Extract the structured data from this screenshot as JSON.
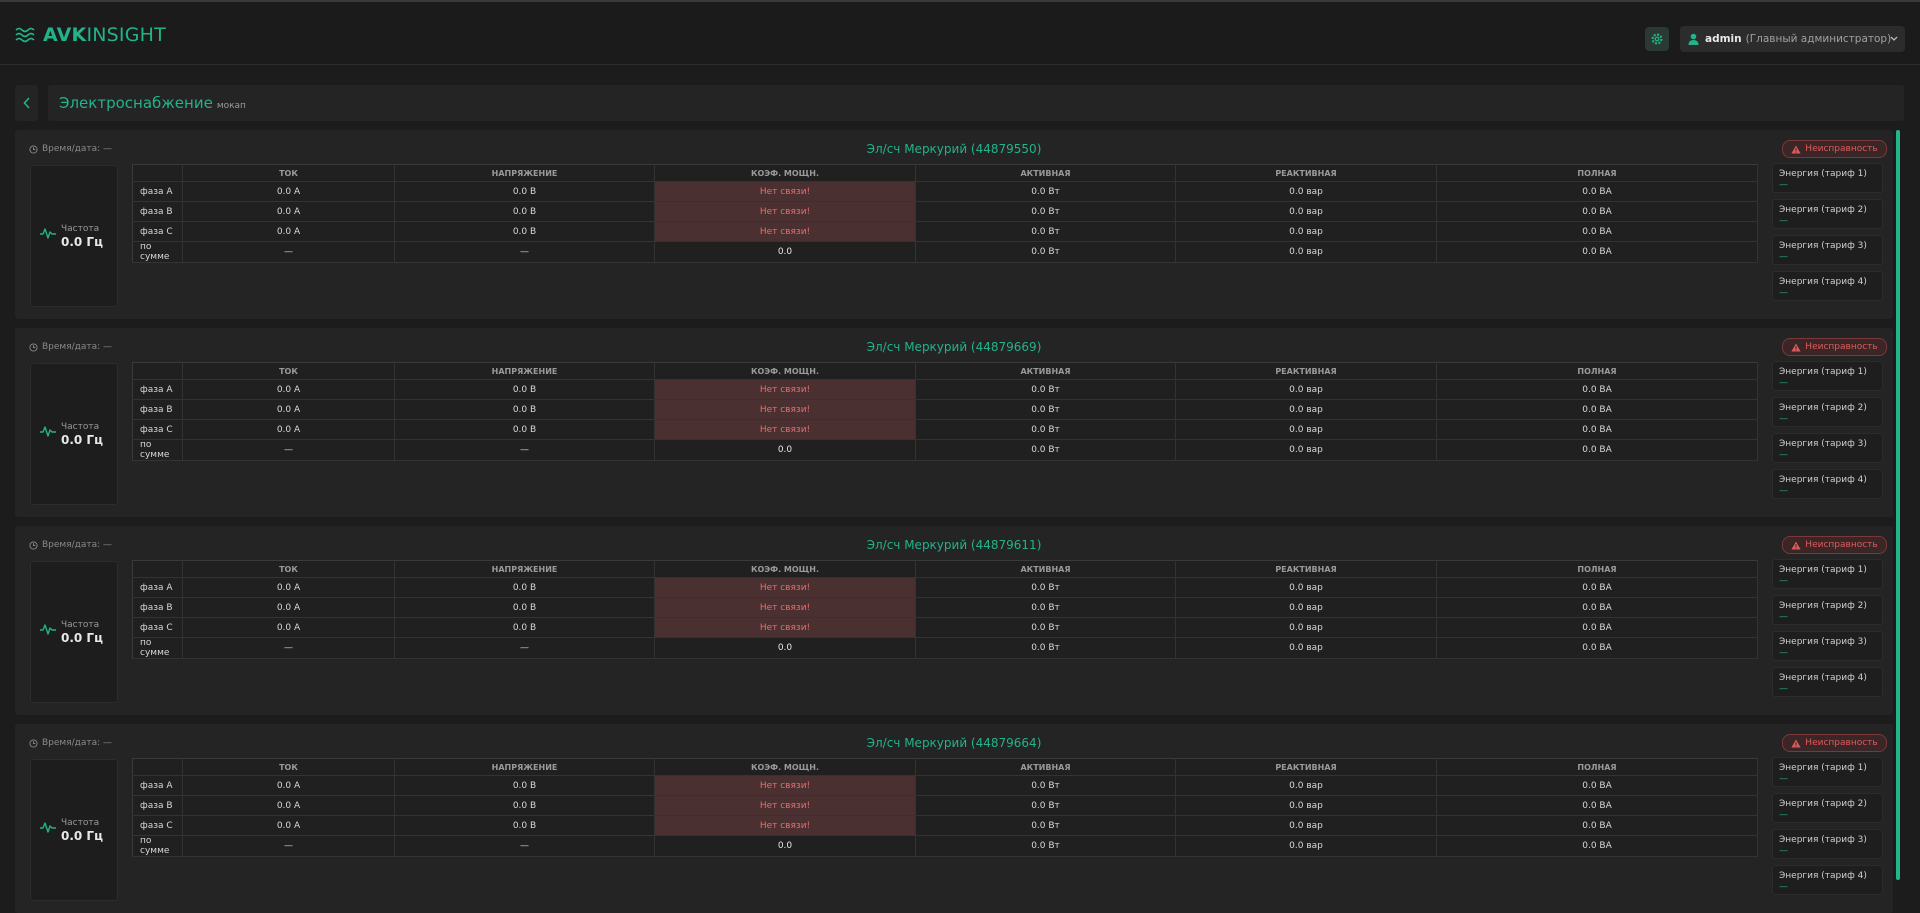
{
  "header": {
    "logo_bold": "AVK",
    "logo_light": "INSIGHT",
    "user_name": "admin",
    "user_role": "(Главный администратор)"
  },
  "page": {
    "title": "Электроснабжение",
    "subtitle": "мокап"
  },
  "meter_labels": {
    "datetime_label": "Время/дата: —",
    "fault_label": "Неисправность",
    "freq_label": "Частота",
    "freq_value": "0.0 Гц",
    "col_current": "ТОК",
    "col_voltage": "НАПРЯЖЕНИЕ",
    "col_pf": "КОЭФ. МОЩН.",
    "col_active": "АКТИВНАЯ",
    "col_reactive": "РЕАКТИВНАЯ",
    "col_full": "ПОЛНАЯ",
    "rows": [
      {
        "phase": "фаза A",
        "current": "0.0 А",
        "voltage": "0.0 В",
        "pf": "Нет связи!",
        "active": "0.0 Вт",
        "reactive": "0.0 вар",
        "full": "0.0 ВА"
      },
      {
        "phase": "фаза B",
        "current": "0.0 А",
        "voltage": "0.0 В",
        "pf": "Нет связи!",
        "active": "0.0 Вт",
        "reactive": "0.0 вар",
        "full": "0.0 ВА"
      },
      {
        "phase": "фаза C",
        "current": "0.0 А",
        "voltage": "0.0 В",
        "pf": "Нет связи!",
        "active": "0.0 Вт",
        "reactive": "0.0 вар",
        "full": "0.0 ВА"
      },
      {
        "phase": "по сумме",
        "current": "—",
        "voltage": "—",
        "pf": "0.0",
        "active": "0.0 Вт",
        "reactive": "0.0 вар",
        "full": "0.0 ВА"
      }
    ],
    "energy": [
      {
        "label": "Энергия (тариф 1)",
        "value": "—"
      },
      {
        "label": "Энергия (тариф 2)",
        "value": "—"
      },
      {
        "label": "Энергия (тариф 3)",
        "value": "—"
      },
      {
        "label": "Энергия (тариф 4)",
        "value": "—"
      }
    ]
  },
  "meters": [
    {
      "title": "Эл/сч Меркурий (44879550)"
    },
    {
      "title": "Эл/сч Меркурий (44879669)"
    },
    {
      "title": "Эл/сч Меркурий (44879611)"
    },
    {
      "title": "Эл/сч Меркурий (44879664)"
    }
  ],
  "colors": {
    "accent": "#22b38a",
    "error": "#e05a5a",
    "error_bg": "#4a3030",
    "background": "#1c1c1c"
  },
  "icons": {
    "logo": "waves-icon",
    "settings": "gear-icon",
    "user": "user-icon",
    "chevron": "chevron-down-icon",
    "back": "chevron-left-icon",
    "clock": "clock-icon",
    "warning": "warning-icon",
    "pulse": "pulse-icon"
  }
}
